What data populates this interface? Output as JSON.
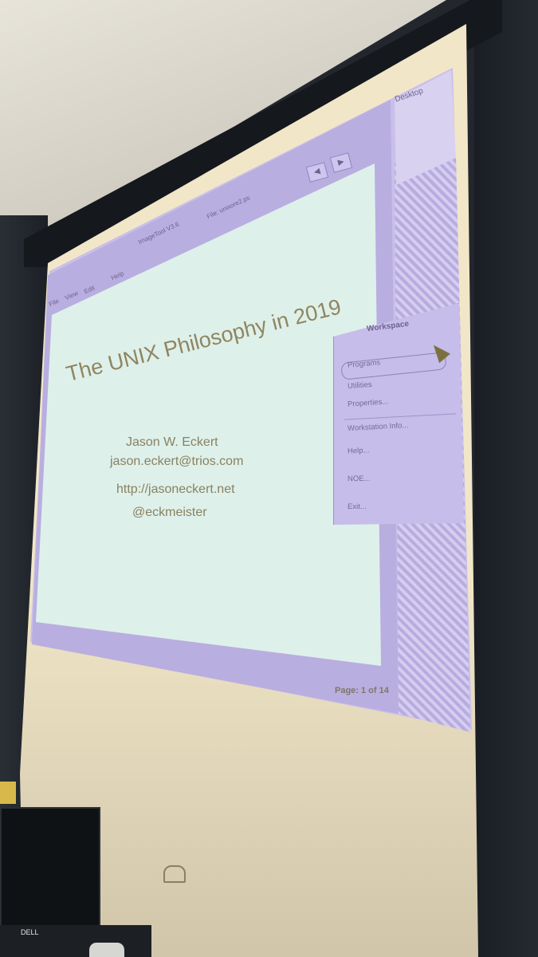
{
  "slide": {
    "title": "The UNIX Philosophy in 2019",
    "author": "Jason W. Eckert",
    "email": "jason.eckert@trios.com",
    "website": "http://jasoneckert.net",
    "handle": "@eckmeister"
  },
  "viewer": {
    "window_title": "ImageTool V3.6",
    "file_label": "File: unixore2.ps",
    "menu": [
      "File",
      "View",
      "Edit",
      "Help"
    ],
    "nav_prev": "◀",
    "nav_next": "▶",
    "page_status": "Page: 1 of 14"
  },
  "desktop": {
    "label": "Desktop"
  },
  "workspace_menu": {
    "title": "Workspace",
    "items": [
      "Programs",
      "Utilities",
      "Properties...",
      "Workstation Info...",
      "Help...",
      "NOE...",
      "Exit..."
    ]
  },
  "room": {
    "monitor_brand": "DELL"
  }
}
